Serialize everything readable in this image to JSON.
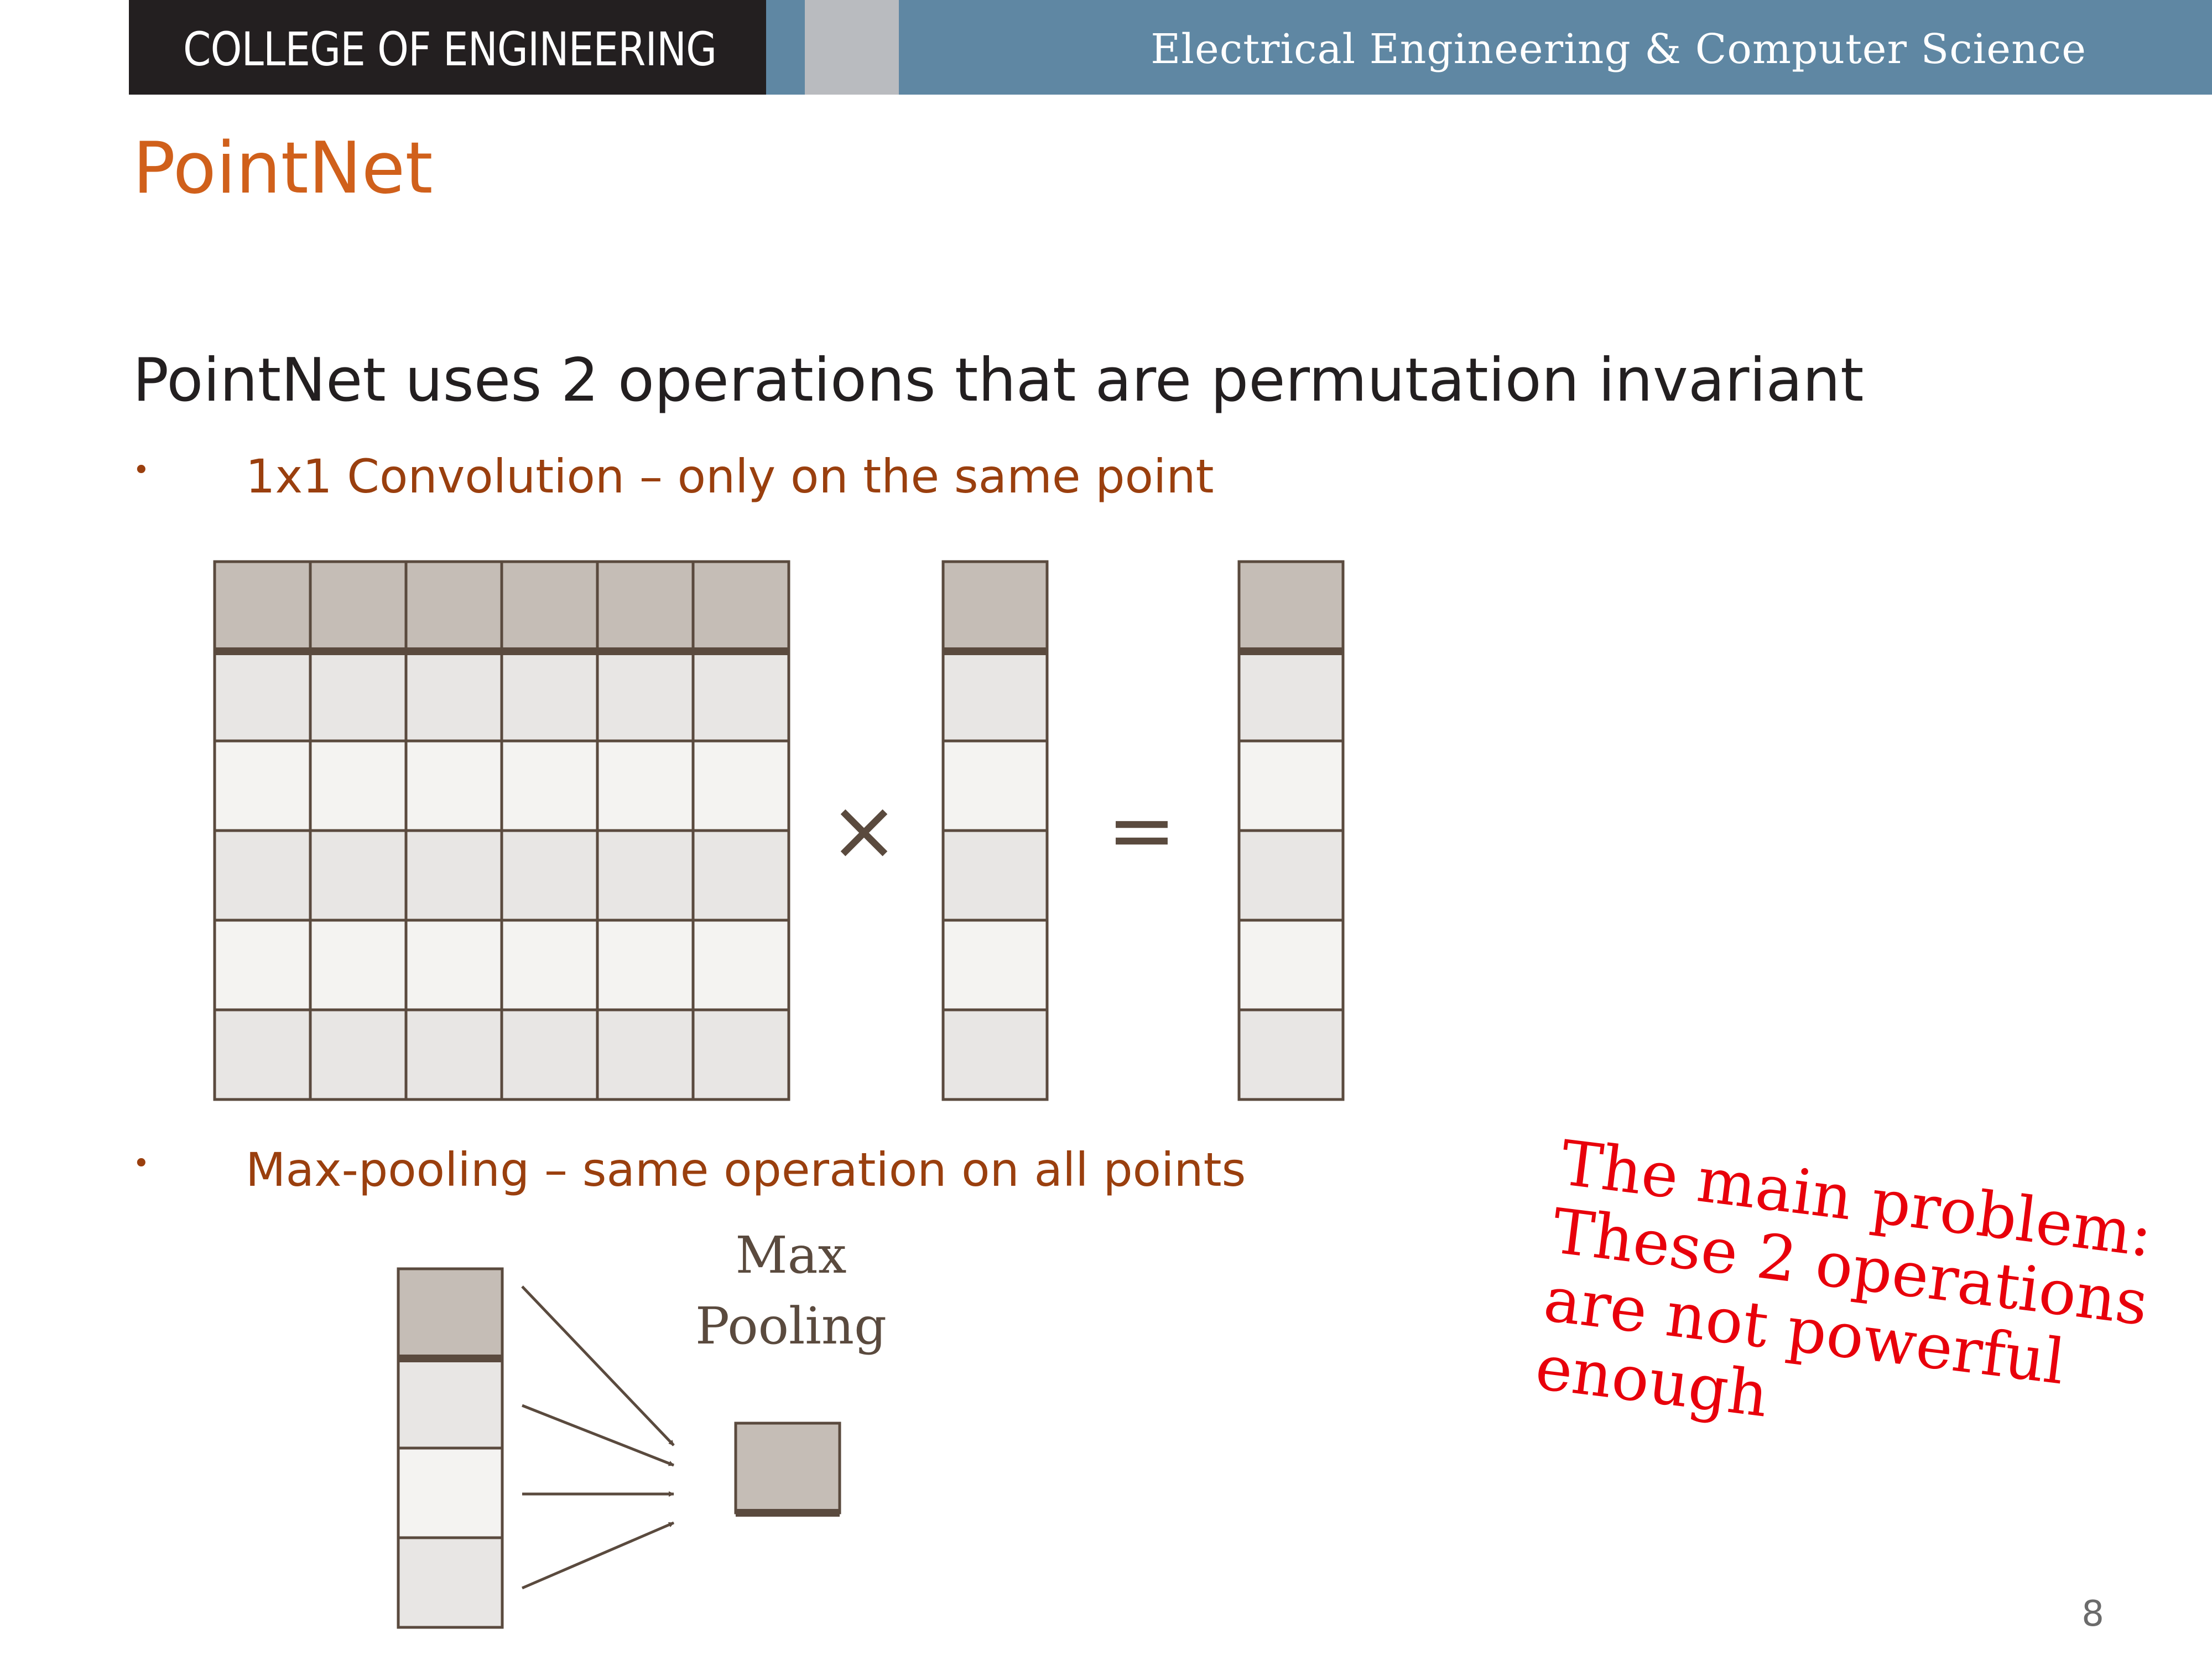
{
  "header": {
    "left_text": "COLLEGE OF ENGINEERING",
    "right_text": "Electrical Engineering & Computer Science",
    "colors": {
      "left_bg": "#231f20",
      "right_bg": "#5f87a3",
      "gray_block": "#b9bbbf"
    }
  },
  "slide": {
    "title": "PointNet",
    "subtitle": "PointNet uses 2 operations that are permutation invariant",
    "bullets": [
      {
        "marker": "•",
        "text": "1x1 Convolution – only on the same point"
      },
      {
        "marker": "•",
        "text": "Max-pooling – same operation on all points"
      }
    ],
    "diagram": {
      "multiply_symbol": "×",
      "equals_symbol": "=",
      "max_pooling_label_line1": "Max",
      "max_pooling_label_line2": "Pooling"
    },
    "note": {
      "lines": [
        "The main problem:",
        "These 2 operations",
        "are not powerful",
        "enough"
      ],
      "color": "#e8000b"
    },
    "page_number": "8"
  },
  "colors": {
    "title": "#d0601b",
    "bullet": "#9a3f0e",
    "cell_header": "#c5bdb6",
    "cell_dark": "#e8e6e4",
    "cell_light": "#f4f3f1",
    "cell_border": "#5a4a3e"
  }
}
